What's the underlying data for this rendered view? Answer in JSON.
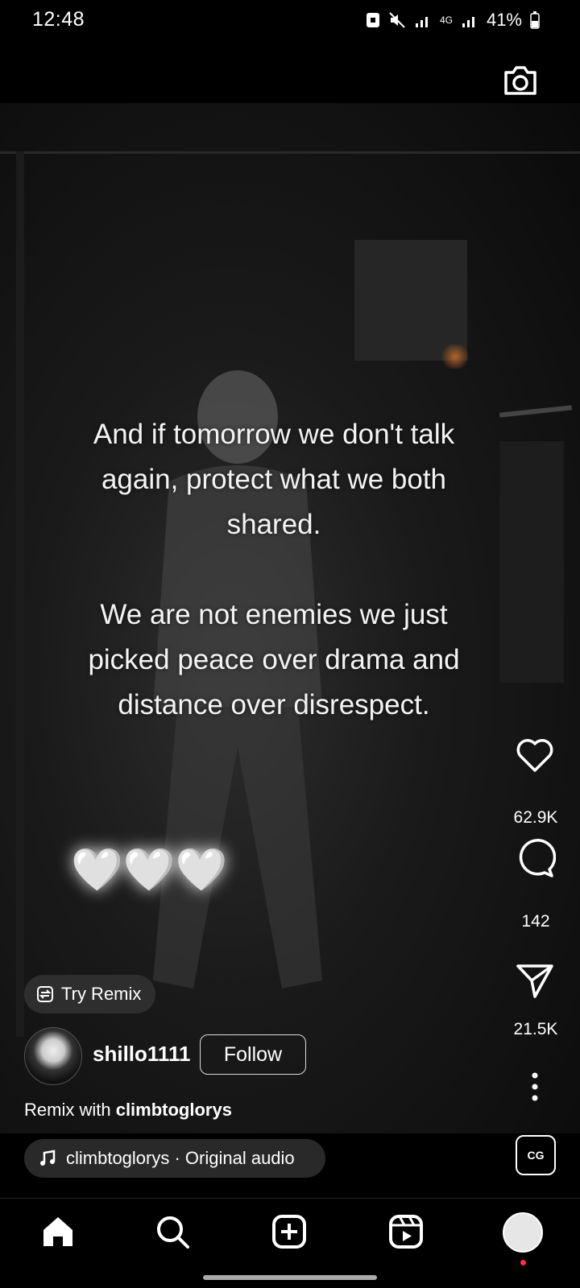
{
  "status_bar": {
    "time": "12:48",
    "network": "4G",
    "battery": "41%"
  },
  "reel": {
    "caption_lines_1": "And if tomorrow we don't talk again, protect what we both shared.",
    "caption_lines_2": "We are not enemies we just picked peace over drama and distance over disrespect.",
    "hearts": "🤍🤍🤍"
  },
  "actions": {
    "likes": "62.9K",
    "comments": "142",
    "shares": "21.5K"
  },
  "creator": {
    "try_remix_label": "Try Remix",
    "username": "shillo1111",
    "follow_label": "Follow",
    "remix_prefix": "Remix with",
    "remix_user": "climbtoglorys"
  },
  "audio": {
    "label": "climbtoglorys · Original audio",
    "thumb_text": "CG"
  },
  "colors": {
    "notification_dot": "#ff3040",
    "background": "#000000"
  }
}
